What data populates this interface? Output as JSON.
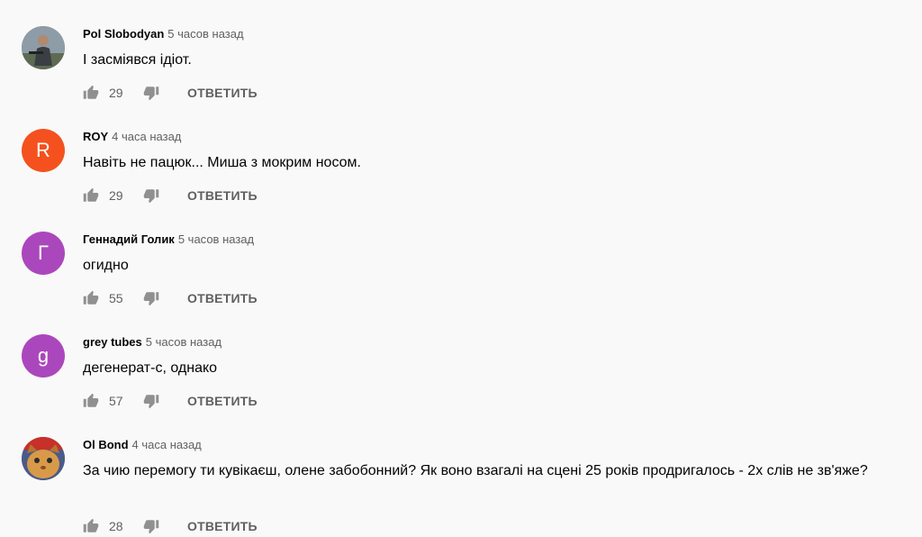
{
  "reply_label": "ОТВЕТИТЬ",
  "comments": [
    {
      "author": "Pol Slobodyan",
      "time": "5 часов назад",
      "text": "І засміявся ідіот.",
      "likes": "29",
      "avatar": {
        "type": "photo",
        "icon": "man-photo-avatar",
        "color": "#7a8a94"
      }
    },
    {
      "author": "ROY",
      "time": "4 часа назад",
      "text": "Навіть не пацюк... Миша з мокрим носом.",
      "likes": "29",
      "avatar": {
        "type": "letter",
        "letter": "R",
        "color": "#f4511e"
      }
    },
    {
      "author": "Геннадий Голик",
      "time": "5 часов назад",
      "text": "огидно",
      "likes": "55",
      "avatar": {
        "type": "letter",
        "letter": "Г",
        "color": "#ab47bc"
      }
    },
    {
      "author": "grey tubes",
      "time": "5 часов назад",
      "text": "дегенерат-с, однако",
      "likes": "57",
      "avatar": {
        "type": "letter",
        "letter": "g",
        "color": "#ab47bc"
      }
    },
    {
      "author": "Ol Bond",
      "time": "4 часа назад",
      "text": "За чию перемогу ти кувікаєш, олене забобонний? Як воно взагалі на сцені 25 років продригалось - 2х слів не зв'яже?",
      "likes": "28",
      "avatar": {
        "type": "photo",
        "icon": "cat-photo-avatar",
        "color": "#d08a3a"
      }
    }
  ]
}
